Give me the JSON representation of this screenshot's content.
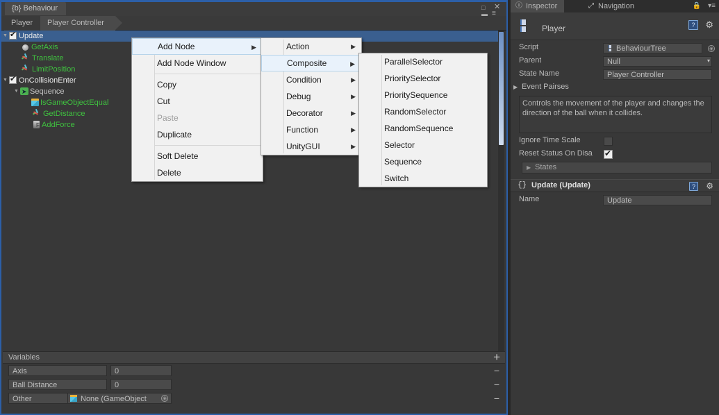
{
  "behaviour_window": {
    "tab_title": "{b} Behaviour",
    "window_buttons": {
      "maximize": "□",
      "close": "✕",
      "lock": "▬",
      "menu": "≡"
    },
    "breadcrumb": [
      "Player",
      "Player Controller"
    ],
    "tree": [
      {
        "indent": 0,
        "arrow": "▼",
        "checkbox": true,
        "icon": "none",
        "label": "Update",
        "color": "white",
        "selected": true
      },
      {
        "indent": 1,
        "arrow": "",
        "checkbox": false,
        "icon": "sphere",
        "label": "GetAxis",
        "color": "green",
        "selected": false
      },
      {
        "indent": 1,
        "arrow": "",
        "checkbox": false,
        "icon": "gizmo",
        "label": "Translate",
        "color": "green",
        "selected": false
      },
      {
        "indent": 1,
        "arrow": "",
        "checkbox": false,
        "icon": "gizmo",
        "label": "LimitPosition",
        "color": "green",
        "selected": false
      },
      {
        "indent": 0,
        "arrow": "▼",
        "checkbox": true,
        "icon": "none",
        "label": "OnCollisionEnter",
        "color": "white",
        "selected": false
      },
      {
        "indent": 1,
        "arrow": "▼",
        "checkbox": false,
        "icon": "sequence",
        "label": "Sequence",
        "color": "grey",
        "selected": false
      },
      {
        "indent": 2,
        "arrow": "",
        "checkbox": false,
        "icon": "cube",
        "label": "IsGameObjectEqual",
        "color": "green",
        "selected": false
      },
      {
        "indent": 2,
        "arrow": "",
        "checkbox": false,
        "icon": "gizmo",
        "label": "GetDistance",
        "color": "green",
        "selected": false
      },
      {
        "indent": 2,
        "arrow": "",
        "checkbox": false,
        "icon": "force",
        "label": "AddForce",
        "color": "green",
        "selected": false
      }
    ],
    "variables": {
      "title": "Variables",
      "add_label": "+",
      "remove_label": "−",
      "rows": [
        {
          "name": "Axis",
          "value": "0",
          "type": "number"
        },
        {
          "name": "Ball Distance",
          "value": "0",
          "type": "number"
        },
        {
          "name": "Other",
          "value": "None (GameObject",
          "type": "object"
        }
      ]
    }
  },
  "context_menu": {
    "level1": {
      "items": [
        {
          "label": "Add Node",
          "submenu": true,
          "disabled": false,
          "highlighted": true,
          "separator_after": false
        },
        {
          "label": "Add Node Window",
          "submenu": false,
          "disabled": false,
          "highlighted": false,
          "separator_after": true
        },
        {
          "label": "Copy",
          "submenu": false,
          "disabled": false,
          "highlighted": false,
          "separator_after": false
        },
        {
          "label": "Cut",
          "submenu": false,
          "disabled": false,
          "highlighted": false,
          "separator_after": false
        },
        {
          "label": "Paste",
          "submenu": false,
          "disabled": true,
          "highlighted": false,
          "separator_after": false
        },
        {
          "label": "Duplicate",
          "submenu": false,
          "disabled": false,
          "highlighted": false,
          "separator_after": true
        },
        {
          "label": "Soft Delete",
          "submenu": false,
          "disabled": false,
          "highlighted": false,
          "separator_after": false
        },
        {
          "label": "Delete",
          "submenu": false,
          "disabled": false,
          "highlighted": false,
          "separator_after": false
        }
      ]
    },
    "level2": {
      "items": [
        {
          "label": "Action",
          "submenu": true,
          "disabled": false,
          "highlighted": false,
          "separator_after": false
        },
        {
          "label": "Composite",
          "submenu": true,
          "disabled": false,
          "highlighted": true,
          "separator_after": false
        },
        {
          "label": "Condition",
          "submenu": true,
          "disabled": false,
          "highlighted": false,
          "separator_after": false
        },
        {
          "label": "Debug",
          "submenu": true,
          "disabled": false,
          "highlighted": false,
          "separator_after": false
        },
        {
          "label": "Decorator",
          "submenu": true,
          "disabled": false,
          "highlighted": false,
          "separator_after": false
        },
        {
          "label": "Function",
          "submenu": true,
          "disabled": false,
          "highlighted": false,
          "separator_after": false
        },
        {
          "label": "UnityGUI",
          "submenu": true,
          "disabled": false,
          "highlighted": false,
          "separator_after": false
        }
      ]
    },
    "level3": {
      "items": [
        {
          "label": "ParallelSelector",
          "submenu": false,
          "disabled": false,
          "highlighted": false,
          "separator_after": false
        },
        {
          "label": "PrioritySelector",
          "submenu": false,
          "disabled": false,
          "highlighted": false,
          "separator_after": false
        },
        {
          "label": "PrioritySequence",
          "submenu": false,
          "disabled": false,
          "highlighted": false,
          "separator_after": false
        },
        {
          "label": "RandomSelector",
          "submenu": false,
          "disabled": false,
          "highlighted": false,
          "separator_after": false
        },
        {
          "label": "RandomSequence",
          "submenu": false,
          "disabled": false,
          "highlighted": false,
          "separator_after": false
        },
        {
          "label": "Selector",
          "submenu": false,
          "disabled": false,
          "highlighted": false,
          "separator_after": false
        },
        {
          "label": "Sequence",
          "submenu": false,
          "disabled": false,
          "highlighted": false,
          "separator_after": false
        },
        {
          "label": "Switch",
          "submenu": false,
          "disabled": false,
          "highlighted": false,
          "separator_after": false
        }
      ]
    },
    "submenu_arrow": "▶"
  },
  "inspector": {
    "tabs": [
      {
        "label": "Inspector",
        "icon": "info-icon",
        "active": true
      },
      {
        "label": "Navigation",
        "icon": "navigation-icon",
        "active": false
      }
    ],
    "lock_icon": "🔒",
    "menu_icon": "▾≡",
    "object_name": "Player",
    "help_label": "?",
    "gear_label": "⚙",
    "properties": [
      {
        "label": "Script",
        "value": "BehaviourTree",
        "kind": "object"
      },
      {
        "label": "Parent",
        "value": "Null",
        "kind": "dropdown"
      },
      {
        "label": "State Name",
        "value": "Player Controller",
        "kind": "text"
      }
    ],
    "event_pairses_label": "Event Pairses",
    "description": "Controls the movement of the player and changes the direction of the ball when it collides.",
    "checkboxes": [
      {
        "label": "Ignore Time Scale",
        "checked": false
      },
      {
        "label": "Reset Status On Disa",
        "checked": true
      }
    ],
    "states_label": "States",
    "component": {
      "icon": "{}",
      "title": "Update (Update)",
      "name_label": "Name",
      "name_value": "Update"
    }
  }
}
